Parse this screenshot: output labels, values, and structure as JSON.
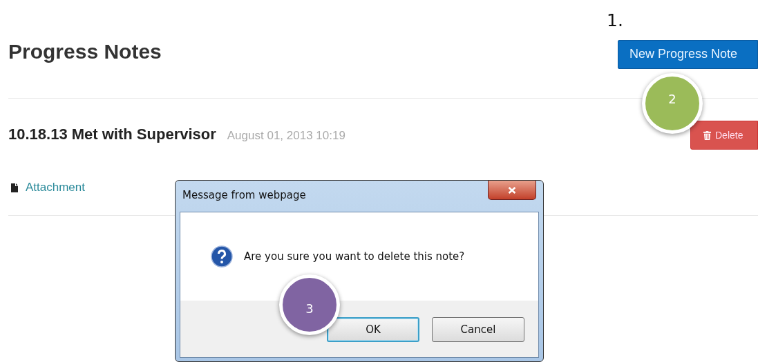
{
  "step_label": "1.",
  "page": {
    "title": "Progress Notes",
    "new_button": "New Progress Note"
  },
  "note": {
    "title": "10.18.13 Met with Supervisor",
    "date": "August 01, 2013 10:19",
    "delete_button": "Delete",
    "attachment": "Attachment"
  },
  "dialog": {
    "title": "Message from webpage",
    "message": "Are you sure you want to delete this note?",
    "buttons": [
      {
        "label": "OK",
        "selected": true
      },
      {
        "label": "Cancel",
        "selected": false
      }
    ]
  },
  "callouts": [
    {
      "label": "2",
      "color": "#9bbb59",
      "kind": "delete"
    },
    {
      "label": "3",
      "color": "#8064a2",
      "kind": "ok"
    }
  ]
}
